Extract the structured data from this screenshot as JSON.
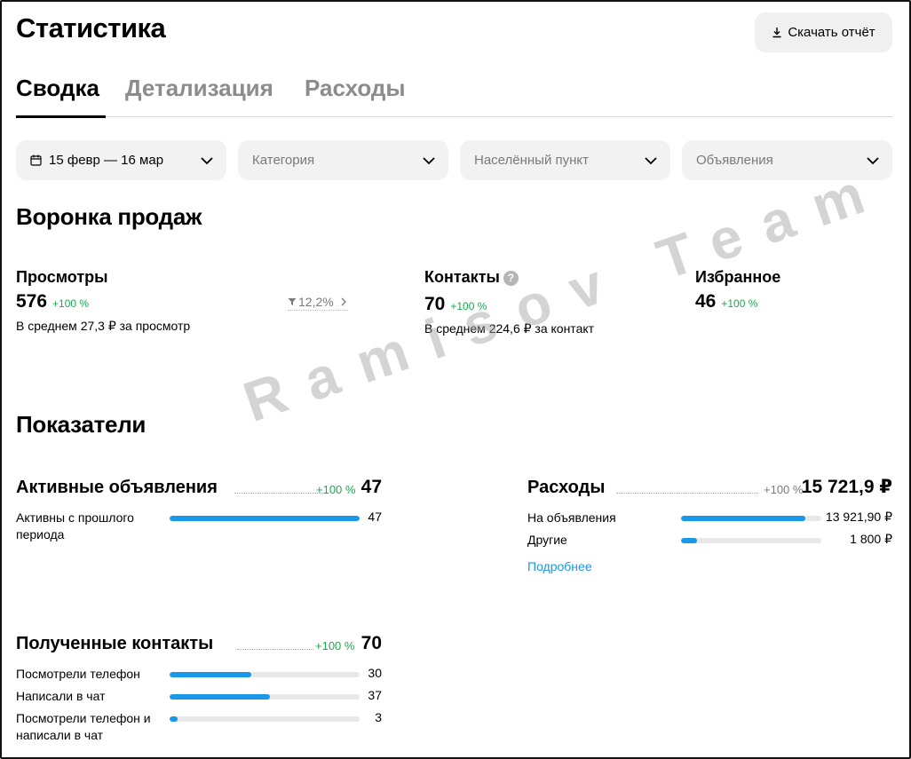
{
  "page": {
    "title": "Статистика"
  },
  "header": {
    "download_label": "Скачать отчёт"
  },
  "tabs": [
    {
      "label": "Сводка",
      "active": true
    },
    {
      "label": "Детализация",
      "active": false
    },
    {
      "label": "Расходы",
      "active": false
    }
  ],
  "filters": {
    "date": "15 февр — 16 мар",
    "category": "Категория",
    "city": "Населённый пункт",
    "ads": "Объявления"
  },
  "funnel": {
    "title": "Воронка продаж",
    "views": {
      "title": "Просмотры",
      "value": "576",
      "delta": "+100 %",
      "sub": "В среднем 27,3 ₽ за просмотр",
      "conversion": "12,2%"
    },
    "contacts": {
      "title": "Контакты",
      "help": "?",
      "value": "70",
      "delta": "+100 %",
      "sub": "В среднем 224,6 ₽ за контакт"
    },
    "favorites": {
      "title": "Избранное",
      "value": "46",
      "delta": "+100 %"
    }
  },
  "indicators": {
    "title": "Показатели",
    "active_ads": {
      "title": "Активные объявления",
      "delta": "+100 %",
      "total": "47",
      "rows": [
        {
          "label": "Активны с прошлого периода",
          "value": "47",
          "fraction": 1.0
        }
      ]
    },
    "expenses": {
      "title": "Расходы",
      "delta": "+100 %",
      "total": "15 721,9 ₽",
      "rows": [
        {
          "label": "На объявления",
          "value": "13 921,90 ₽",
          "fraction": 0.885
        },
        {
          "label": "Другие",
          "value": "1 800 ₽",
          "fraction": 0.114
        }
      ],
      "more_label": "Подробнее"
    },
    "contacts": {
      "title": "Полученные контакты",
      "delta": "+100 %",
      "total": "70",
      "rows": [
        {
          "label": "Посмотрели телефон",
          "value": "30",
          "fraction": 0.43
        },
        {
          "label": "Написали в чат",
          "value": "37",
          "fraction": 0.53
        },
        {
          "label": "Посмотрели телефон и написали в чат",
          "value": "3",
          "fraction": 0.043
        }
      ]
    }
  },
  "watermark": "Ramisov Team",
  "colors": {
    "accent": "#1a98e8",
    "positive": "#1aaa4e",
    "bar_track": "#e8e8e8",
    "filter_bg": "#f2f2f2"
  }
}
